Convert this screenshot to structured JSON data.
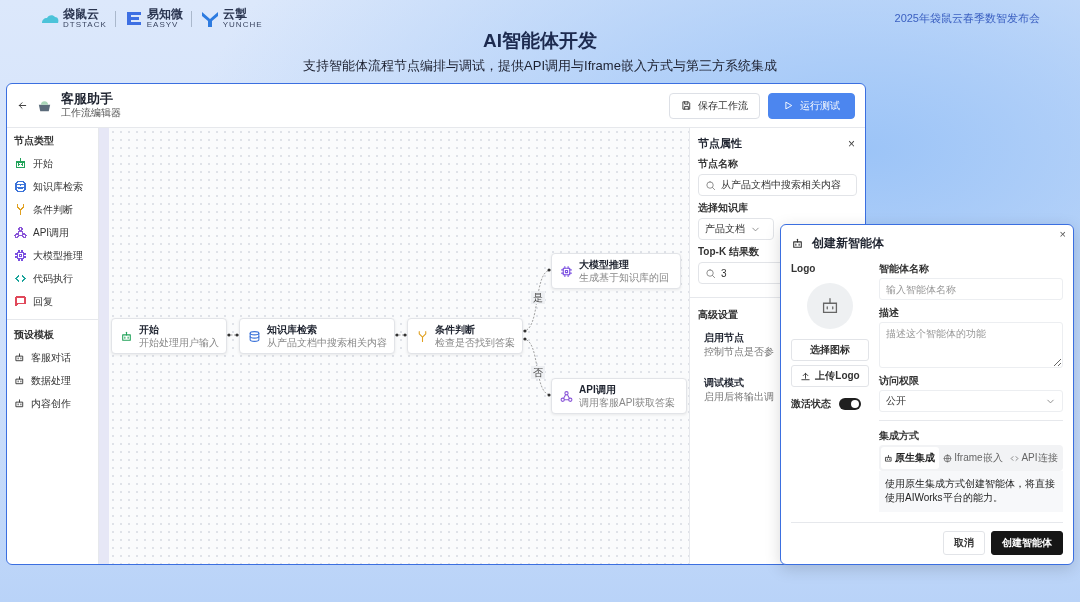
{
  "header": {
    "logos": [
      {
        "name": "袋鼠云",
        "sub": "DTSTACK"
      },
      {
        "name": "易知微",
        "sub": "EASYV"
      },
      {
        "name": "云掣",
        "sub": "YUNCHE"
      }
    ],
    "event": "2025年袋鼠云春季数智发布会"
  },
  "title": "AI智能体开发",
  "subtitle": "支持智能体流程节点编排与调试，提供API调用与Iframe嵌入方式与第三方系统集成",
  "editor": {
    "title": "客服助手",
    "subtitle": "工作流编辑器",
    "buttons": [
      {
        "label": "保存工作流",
        "kind": "save"
      },
      {
        "label": "运行测试",
        "kind": "run"
      }
    ],
    "sidebar": {
      "node_types_heading": "节点类型",
      "node_types": [
        {
          "label": "开始",
          "kind": "start",
          "color": "#22a35a"
        },
        {
          "label": "知识库检索",
          "kind": "knowledge",
          "color": "#3b73d9"
        },
        {
          "label": "条件判断",
          "kind": "condition",
          "color": "#e0a020"
        },
        {
          "label": "API调用",
          "kind": "api",
          "color": "#8a56d8"
        },
        {
          "label": "大模型推理",
          "kind": "llm",
          "color": "#7a4fe0"
        },
        {
          "label": "代码执行",
          "kind": "code",
          "color": "#1aa39a"
        },
        {
          "label": "回复",
          "kind": "reply",
          "color": "#e0485a"
        }
      ],
      "templates_heading": "预设模板",
      "templates": [
        "客服对话",
        "数据处理",
        "内容创作"
      ]
    },
    "canvas": {
      "nodes": [
        {
          "title": "开始",
          "desc": "开始处理用户输入",
          "kind": "start"
        },
        {
          "title": "知识库检索",
          "desc": "从产品文档中搜索相关内容",
          "kind": "knowledge"
        },
        {
          "title": "条件判断",
          "desc": "检查是否找到答案",
          "kind": "condition"
        },
        {
          "title": "大模型推理",
          "desc": "生成基于知识库的回",
          "kind": "llm"
        },
        {
          "title": "API调用",
          "desc": "调用客服API获取答案",
          "kind": "api"
        }
      ],
      "edge_labels": [
        "是",
        "否"
      ]
    },
    "properties": {
      "title": "节点属性",
      "close": "×",
      "fields": [
        {
          "label": "节点名称",
          "value": "从产品文档中搜索相关内容",
          "kind": "search"
        },
        {
          "label": "选择知识库",
          "value": "产品文档",
          "kind": "select"
        },
        {
          "label": "Top-K 结果数",
          "value": "3",
          "kind": "search"
        }
      ],
      "advanced_heading": "高级设置",
      "advanced": [
        {
          "label": "启用节点",
          "desc": "控制节点是否参"
        },
        {
          "label": "调试模式",
          "desc": "启用后将输出调"
        }
      ]
    }
  },
  "dialog": {
    "title": "创建新智能体",
    "close": "×",
    "logo_label": "Logo",
    "choose_icon": "选择图标",
    "upload": "上传Logo",
    "active": {
      "label": "激活状态",
      "on": true
    },
    "name": {
      "label": "智能体名称",
      "placeholder": "输入智能体名称"
    },
    "description": {
      "label": "描述",
      "placeholder": "描述这个智能体的功能"
    },
    "access": {
      "label": "访问权限",
      "value": "公开"
    },
    "integration": {
      "label": "集成方式",
      "tabs": [
        {
          "label": "原生集成",
          "kind": "native",
          "selected": true
        },
        {
          "label": "Iframe嵌入",
          "kind": "iframe",
          "selected": false
        },
        {
          "label": "API连接",
          "kind": "api",
          "selected": false
        }
      ],
      "note": "使用原生集成方式创建智能体，将直接使用AIWorks平台的能力。"
    },
    "buttons": [
      {
        "label": "取消",
        "kind": "secondary"
      },
      {
        "label": "创建智能体",
        "kind": "primary"
      }
    ]
  }
}
